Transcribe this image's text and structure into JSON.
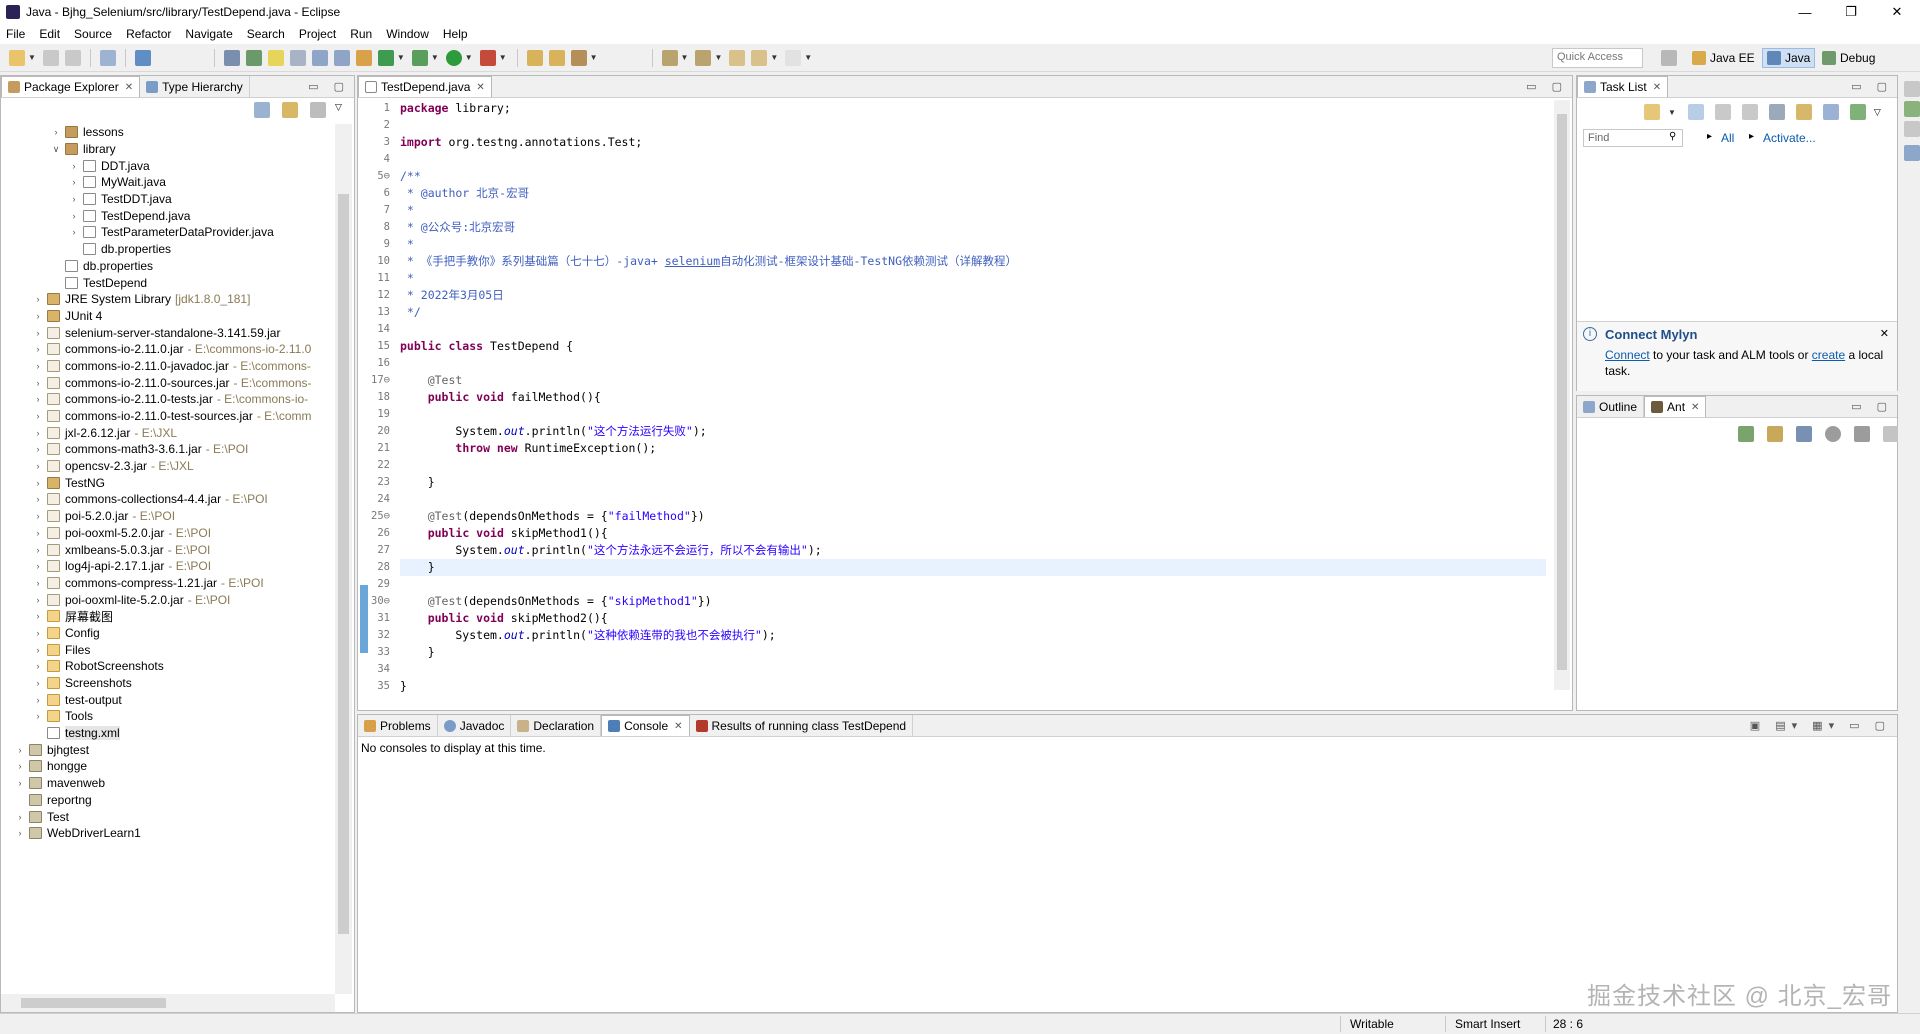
{
  "window": {
    "title": "Java - Bjhg_Selenium/src/library/TestDepend.java - Eclipse",
    "buttons": [
      "—",
      "❐",
      "✕"
    ]
  },
  "menu": [
    "File",
    "Edit",
    "Source",
    "Refactor",
    "Navigate",
    "Search",
    "Project",
    "Run",
    "Window",
    "Help"
  ],
  "toolbar": {
    "quick_access": "Quick Access",
    "perspectives": [
      "Java EE",
      "Java",
      "Debug"
    ]
  },
  "package_explorer": {
    "tabs": [
      "Package Explorer",
      "Type Hierarchy"
    ],
    "tree": [
      {
        "indent": 3,
        "arrow": "›",
        "icon": "pkg",
        "label": "lessons"
      },
      {
        "indent": 3,
        "arrow": "∨",
        "icon": "pkg",
        "label": "library"
      },
      {
        "indent": 4,
        "arrow": "›",
        "icon": "java",
        "label": "DDT.java"
      },
      {
        "indent": 4,
        "arrow": "›",
        "icon": "java",
        "label": "MyWait.java"
      },
      {
        "indent": 4,
        "arrow": "›",
        "icon": "java",
        "label": "TestDDT.java"
      },
      {
        "indent": 4,
        "arrow": "›",
        "icon": "java",
        "label": "TestDepend.java"
      },
      {
        "indent": 4,
        "arrow": "›",
        "icon": "java",
        "label": "TestParameterDataProvider.java"
      },
      {
        "indent": 4,
        "arrow": "",
        "icon": "file",
        "label": "db.properties"
      },
      {
        "indent": 3,
        "arrow": "",
        "icon": "file",
        "label": "db.properties"
      },
      {
        "indent": 3,
        "arrow": "",
        "icon": "file",
        "label": "TestDepend"
      },
      {
        "indent": 2,
        "arrow": "›",
        "icon": "lib",
        "label": "JRE System Library",
        "sub": "[jdk1.8.0_181]"
      },
      {
        "indent": 2,
        "arrow": "›",
        "icon": "lib",
        "label": "JUnit 4"
      },
      {
        "indent": 2,
        "arrow": "›",
        "icon": "jar",
        "label": "selenium-server-standalone-3.141.59.jar"
      },
      {
        "indent": 2,
        "arrow": "›",
        "icon": "jar",
        "label": "commons-io-2.11.0.jar",
        "sub": "- E:\\commons-io-2.11.0"
      },
      {
        "indent": 2,
        "arrow": "›",
        "icon": "jar",
        "label": "commons-io-2.11.0-javadoc.jar",
        "sub": "- E:\\commons-"
      },
      {
        "indent": 2,
        "arrow": "›",
        "icon": "jar",
        "label": "commons-io-2.11.0-sources.jar",
        "sub": "- E:\\commons-"
      },
      {
        "indent": 2,
        "arrow": "›",
        "icon": "jar",
        "label": "commons-io-2.11.0-tests.jar",
        "sub": "- E:\\commons-io-"
      },
      {
        "indent": 2,
        "arrow": "›",
        "icon": "jar",
        "label": "commons-io-2.11.0-test-sources.jar",
        "sub": "- E:\\comm"
      },
      {
        "indent": 2,
        "arrow": "›",
        "icon": "jar",
        "label": "jxl-2.6.12.jar",
        "sub": "- E:\\JXL"
      },
      {
        "indent": 2,
        "arrow": "›",
        "icon": "jar",
        "label": "commons-math3-3.6.1.jar",
        "sub": "- E:\\POI"
      },
      {
        "indent": 2,
        "arrow": "›",
        "icon": "jar",
        "label": "opencsv-2.3.jar",
        "sub": "- E:\\JXL"
      },
      {
        "indent": 2,
        "arrow": "›",
        "icon": "lib",
        "label": "TestNG"
      },
      {
        "indent": 2,
        "arrow": "›",
        "icon": "jar",
        "label": "commons-collections4-4.4.jar",
        "sub": "- E:\\POI"
      },
      {
        "indent": 2,
        "arrow": "›",
        "icon": "jar",
        "label": "poi-5.2.0.jar",
        "sub": "- E:\\POI"
      },
      {
        "indent": 2,
        "arrow": "›",
        "icon": "jar",
        "label": "poi-ooxml-5.2.0.jar",
        "sub": "- E:\\POI"
      },
      {
        "indent": 2,
        "arrow": "›",
        "icon": "jar",
        "label": "xmlbeans-5.0.3.jar",
        "sub": "- E:\\POI"
      },
      {
        "indent": 2,
        "arrow": "›",
        "icon": "jar",
        "label": "log4j-api-2.17.1.jar",
        "sub": "- E:\\POI"
      },
      {
        "indent": 2,
        "arrow": "›",
        "icon": "jar",
        "label": "commons-compress-1.21.jar",
        "sub": "- E:\\POI"
      },
      {
        "indent": 2,
        "arrow": "›",
        "icon": "jar",
        "label": "poi-ooxml-lite-5.2.0.jar",
        "sub": "- E:\\POI"
      },
      {
        "indent": 2,
        "arrow": "›",
        "icon": "folder",
        "label": "屏幕截图"
      },
      {
        "indent": 2,
        "arrow": "›",
        "icon": "folder",
        "label": "Config"
      },
      {
        "indent": 2,
        "arrow": "›",
        "icon": "folder",
        "label": "Files"
      },
      {
        "indent": 2,
        "arrow": "›",
        "icon": "folder",
        "label": "RobotScreenshots"
      },
      {
        "indent": 2,
        "arrow": "›",
        "icon": "folder",
        "label": "Screenshots"
      },
      {
        "indent": 2,
        "arrow": "›",
        "icon": "folder",
        "label": "test-output"
      },
      {
        "indent": 2,
        "arrow": "›",
        "icon": "folder",
        "label": "Tools"
      },
      {
        "indent": 2,
        "arrow": "",
        "icon": "file",
        "label": "testng.xml",
        "selected": true
      },
      {
        "indent": 1,
        "arrow": "›",
        "icon": "proj",
        "label": "bjhgtest"
      },
      {
        "indent": 1,
        "arrow": "›",
        "icon": "proj",
        "label": "hongge"
      },
      {
        "indent": 1,
        "arrow": "›",
        "icon": "proj",
        "label": "mavenweb"
      },
      {
        "indent": 1,
        "arrow": "",
        "icon": "proj",
        "label": "reportng"
      },
      {
        "indent": 1,
        "arrow": "›",
        "icon": "proj",
        "label": "Test"
      },
      {
        "indent": 1,
        "arrow": "›",
        "icon": "proj",
        "label": "WebDriverLearn1"
      }
    ]
  },
  "editor": {
    "tab": "TestDepend.java",
    "lines": [
      {
        "n": "1",
        "html": "<span class=\"kw\">package</span> library;"
      },
      {
        "n": "2",
        "html": ""
      },
      {
        "n": "3",
        "html": "<span class=\"kw\">import</span> org.testng.annotations.Test;"
      },
      {
        "n": "4",
        "html": ""
      },
      {
        "n": "5⊖",
        "html": "<span class=\"jd\">/**</span>"
      },
      {
        "n": "6",
        "html": "<span class=\"jd\"> * @author 北京-宏哥</span>"
      },
      {
        "n": "7",
        "html": "<span class=\"jd\"> *</span>"
      },
      {
        "n": "8",
        "html": "<span class=\"jd\"> * @公众号:北京宏哥</span>"
      },
      {
        "n": "9",
        "html": "<span class=\"jd\"> *</span>"
      },
      {
        "n": "10",
        "html": "<span class=\"jd\"> * 《手把手教你》系列基础篇（七十七）-java+ <u>selenium</u>自动化测试-框架设计基础-TestNG依赖测试（详解教程）</span>"
      },
      {
        "n": "11",
        "html": "<span class=\"jd\"> *</span>"
      },
      {
        "n": "12",
        "html": "<span class=\"jd\"> * 2022年3月05日</span>"
      },
      {
        "n": "13",
        "html": "<span class=\"jd\"> */</span>"
      },
      {
        "n": "14",
        "html": ""
      },
      {
        "n": "15",
        "html": "<span class=\"kw\">public class</span> TestDepend {"
      },
      {
        "n": "16",
        "html": ""
      },
      {
        "n": "17⊖",
        "html": "    <span class=\"an\">@Test</span>"
      },
      {
        "n": "18",
        "html": "    <span class=\"kw\">public void</span> failMethod(){"
      },
      {
        "n": "19",
        "html": ""
      },
      {
        "n": "20",
        "html": "        System.<span class=\"fld\">out</span>.println(<span class=\"st\">\"这个方法运行失败\"</span>);"
      },
      {
        "n": "21",
        "html": "        <span class=\"kw\">throw new</span> RuntimeException();"
      },
      {
        "n": "22",
        "html": ""
      },
      {
        "n": "23",
        "html": "    }"
      },
      {
        "n": "24",
        "html": ""
      },
      {
        "n": "25⊖",
        "html": "    <span class=\"an\">@Test</span>(dependsOnMethods = {<span class=\"st\">\"failMethod\"</span>})"
      },
      {
        "n": "26",
        "html": "    <span class=\"kw\">public void</span> skipMethod1(){"
      },
      {
        "n": "27",
        "html": "        System.<span class=\"fld\">out</span>.println(<span class=\"st\">\"这个方法永远不会运行，所以不会有输出\"</span>);"
      },
      {
        "n": "28",
        "html": "    }",
        "current": true
      },
      {
        "n": "29",
        "html": ""
      },
      {
        "n": "30⊖",
        "html": "    <span class=\"an\">@Test</span>(dependsOnMethods = {<span class=\"st\">\"skipMethod1\"</span>})"
      },
      {
        "n": "31",
        "html": "    <span class=\"kw\">public void</span> skipMethod2(){"
      },
      {
        "n": "32",
        "html": "        System.<span class=\"fld\">out</span>.println(<span class=\"st\">\"这种依赖连带的我也不会被执行\"</span>);"
      },
      {
        "n": "33",
        "html": "    }"
      },
      {
        "n": "34",
        "html": ""
      },
      {
        "n": "35",
        "html": "}"
      }
    ]
  },
  "tasklist": {
    "tab": "Task List",
    "find_placeholder": "Find",
    "all": "All",
    "activate": "Activate...",
    "mylyn_title": "Connect Mylyn",
    "mylyn_connect": "Connect",
    "mylyn_text1": " to your task and ALM tools or ",
    "mylyn_create": "create",
    "mylyn_text2": " a local task."
  },
  "outline": {
    "tabs": [
      "Outline",
      "Ant"
    ]
  },
  "console": {
    "tabs": [
      "Problems",
      "Javadoc",
      "Declaration",
      "Console",
      "Results of running class TestDepend"
    ],
    "message": "No consoles to display at this time."
  },
  "status": {
    "writable": "Writable",
    "insert_mode": "Smart Insert",
    "position": "28 : 6"
  },
  "watermark": "掘金技术社区 @ 北京_宏哥"
}
